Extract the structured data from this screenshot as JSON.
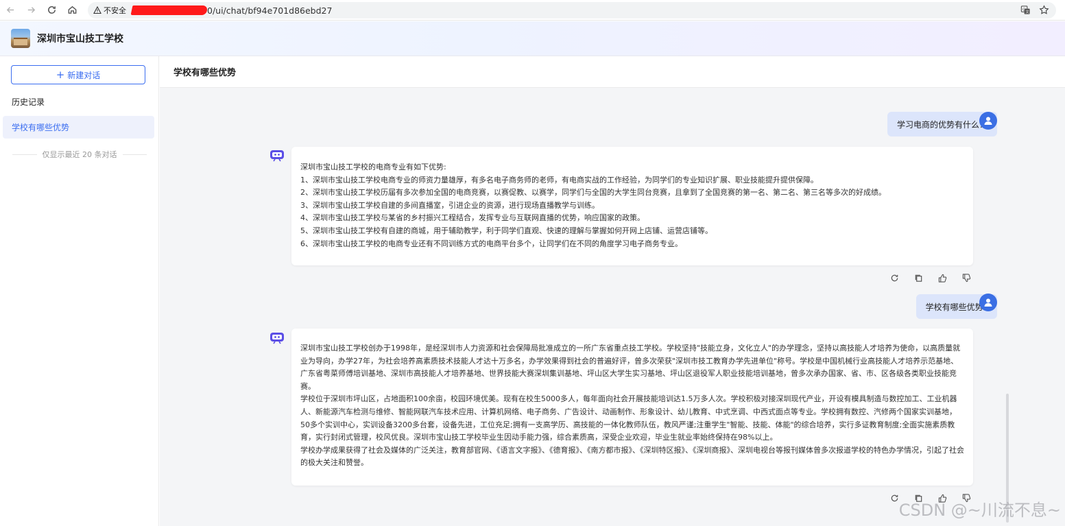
{
  "browser": {
    "security_label": "不安全",
    "url_visible": "0/ui/chat/bf94e701d86ebd27",
    "icons": [
      "arrow-left-icon",
      "arrow-right-icon",
      "reload-icon",
      "home-icon",
      "warning-icon",
      "translate-icon",
      "star-icon"
    ]
  },
  "app": {
    "school_name": "深圳市宝山技工学校"
  },
  "sidebar": {
    "new_chat_label": "新建对话",
    "history_title": "历史记录",
    "items": [
      {
        "label": "学校有哪些优势",
        "active": true
      }
    ],
    "limit_note": "仅显示最近 20 条对话"
  },
  "main": {
    "title": "学校有哪些优势"
  },
  "messages": [
    {
      "role": "user",
      "text": "学习电商的优势有什么？"
    },
    {
      "role": "assistant",
      "lines": [
        "深圳市宝山技工学校的电商专业有如下优势:",
        "1、深圳市宝山技工学校电商专业的师资力量雄厚，有多名电子商务师的老师，有电商实战的工作经验，为同学们的专业知识扩展、职业技能提升提供保障。",
        "2、深圳市宝山技工学校历届有多次参加全国的电商竞赛，以赛促教、以赛学，同学们与全国的大学生同台竞赛，且拿到了全国竞赛的第一名、第二名、第三名等多次的好成绩。",
        "3、深圳市宝山技工学校自建的多间直播室，引进企业的资源，进行现场直播教学与训练。",
        "4、深圳市宝山技工学校与某省的乡村振兴工程结合，发挥专业与互联网直播的优势，响应国家的政策。",
        "5、深圳市宝山技工学校有自建的商城，用于辅助教学，利于同学们直观、快速的理解与掌握如何开网上店铺、运营店铺等。",
        "6、深圳市宝山技工学校的电商专业还有不同训练方式的电商平台多个，让同学们在不同的角度学习电子商务专业。"
      ]
    },
    {
      "role": "user",
      "text": "学校有哪些优势?"
    },
    {
      "role": "assistant",
      "lines": [
        "深圳市宝山技工学校创办于1998年，是经深圳市人力资源和社会保障局批准成立的一所广东省重点技工学校。学校坚持\"技能立身，文化立人\"的办学理念，坚持以高技能人才培养为使命，以高质量就业为导向，办学27年，为社会培养高素质技术技能人才达十万多名，办学效果得到社会的普遍好评，曾多次荣获\"深圳市技工教育办学先进单位\"称号。学校是中国机械行业高技能人才培养示范基地、广东省粤菜师傅培训基地、深圳市高技能人才培养基地、世界技能大赛深圳集训基地、坪山区大学生实习基地、坪山区退役军人职业技能培训基地，曾多次承办国家、省、市、区各级各类职业技能竞赛。",
        "学校位于深圳市坪山区，占地面积100余亩，校园环境优美。现有在校生5000多人，每年面向社会开展技能培训达1.5万多人次。学校积极对接深圳现代产业，开设有模具制造与数控加工、工业机器人、新能源汽车检测与维修、智能网联汽车技术应用、计算机网络、电子商务、广告设计、动画制作、形象设计、幼儿教育、中式烹调、中西式面点等专业。学校拥有数控、汽修两个国家实训基地，50多个实训中心，实训设备3200多台套，设备先进，工位充足;拥有一支高学历、高技能的一体化教师队伍，教风严谨;注重学生\"智能、技能、体能\"的综合培养，实行多证教育制度;全面实施素质教育，实行封闭式管理，校风优良。深圳市宝山技工学校毕业生因动手能力强，综合素质高，深受企业欢迎，毕业生就业率始终保持在98%以上。",
        "学校办学成果获得了社会及媒体的广泛关注，教育部官网、《语言文字报》、《德育报》、《南方都市报》、《深圳特区报》、《深圳商报》、深圳电视台等报刊媒体曾多次报道学校的特色办学情况，引起了社会的极大关注和赞誉。"
      ]
    }
  ],
  "action_icons": [
    "refresh-icon",
    "copy-icon",
    "thumbs-up-icon",
    "thumbs-down-icon"
  ],
  "watermark": "CSDN @~川流不息~",
  "colors": {
    "accent": "#3a6df0",
    "user_bubble": "#dce5fb",
    "avatar": "#3b6fe4",
    "bot_icon": "#5b4ee6"
  }
}
